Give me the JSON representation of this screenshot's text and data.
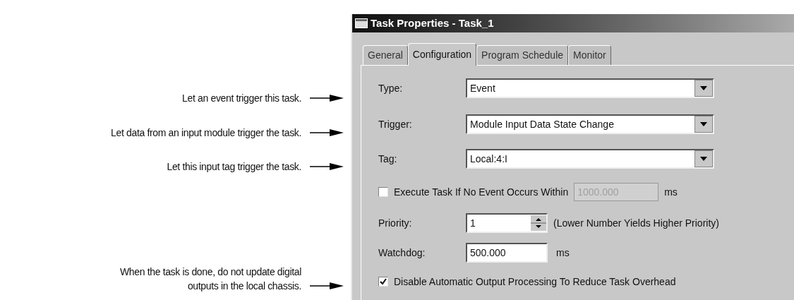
{
  "callouts": [
    {
      "lines": [
        "Let an event trigger this task."
      ]
    },
    {
      "lines": [
        "Let data from an input module trigger the task."
      ]
    },
    {
      "lines": [
        "Let this input tag trigger the task."
      ]
    },
    {
      "lines": [
        "When the task is done, do not update digital",
        "outputs in the local chassis."
      ]
    }
  ],
  "window": {
    "title": "Task Properties - Task_1"
  },
  "tabs": [
    {
      "label": "General",
      "selected": false
    },
    {
      "label": "Configuration",
      "selected": true
    },
    {
      "label": "Program Schedule",
      "selected": false
    },
    {
      "label": "Monitor",
      "selected": false
    }
  ],
  "rows": [
    {
      "kind": "select",
      "label": "Type:",
      "value": "Event"
    },
    {
      "kind": "select",
      "label": "Trigger:",
      "value": "Module Input Data State Change"
    },
    {
      "kind": "select",
      "label": "Tag:",
      "value": "Local:4:I"
    },
    {
      "kind": "checkfield",
      "label": "Execute Task If No Event Occurs Within",
      "checked": false,
      "value": "1000.000",
      "disabled": true,
      "unit": "ms"
    },
    {
      "kind": "spinner",
      "label": "Priority:",
      "value": "1",
      "note": "(Lower Number Yields Higher Priority)"
    },
    {
      "kind": "field",
      "label": "Watchdog:",
      "value": "500.000",
      "unit": "ms"
    },
    {
      "kind": "check",
      "label": "Disable Automatic Output Processing To Reduce Task Overhead",
      "checked": true
    }
  ]
}
